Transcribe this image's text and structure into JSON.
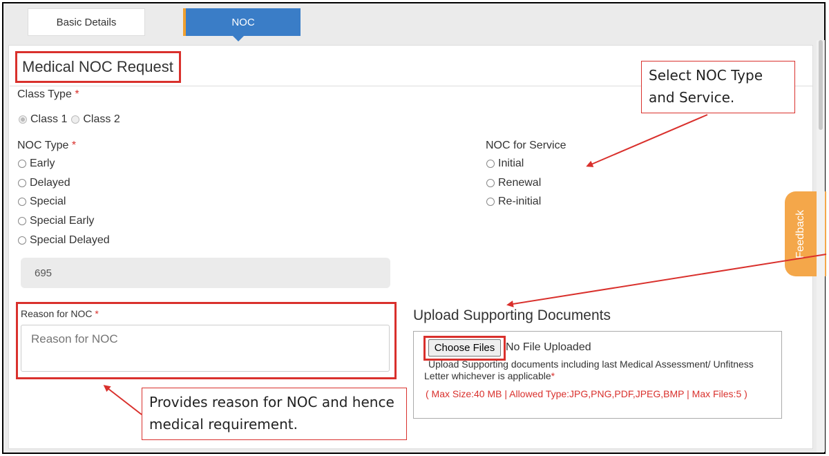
{
  "tabs": [
    {
      "label": "Basic Details"
    },
    {
      "label": "NOC"
    }
  ],
  "form": {
    "title": "Medical NOC Request",
    "class_type": {
      "label": "Class Type",
      "required_mark": "*",
      "options": [
        "Class 1",
        "Class 2"
      ],
      "selected": "Class 1"
    },
    "noc_type": {
      "label": "NOC Type",
      "required_mark": "*",
      "options": [
        "Early",
        "Delayed",
        "Special",
        "Special Early",
        "Special Delayed"
      ]
    },
    "noc_service": {
      "label": "NOC for Service",
      "options": [
        "Initial",
        "Renewal",
        "Re-initial"
      ]
    },
    "readonly_value": "695",
    "reason": {
      "label": "Reason for NOC",
      "required_mark": "*",
      "placeholder": "Reason for NOC"
    }
  },
  "upload": {
    "title": "Upload Supporting Documents",
    "button_label": "Choose Files",
    "status": "No File Uploaded",
    "help_text": "Upload Supporting documents including last Medical Assessment/ Unfitness Letter whichever is applicable",
    "required_mark": "*",
    "limits": "( Max Size:40 MB | Allowed Type:JPG,PNG,PDF,JPEG,BMP | Max Files:5 )"
  },
  "callouts": {
    "noc": "Select NOC Type and Service.",
    "reason": "Provides reason for NOC and hence medical requirement."
  },
  "feedback": {
    "label": "Feedback"
  },
  "colors": {
    "tab_active": "#3a7dc7",
    "tab_accent": "#f0a030",
    "annotation_red": "#d9302c",
    "feedback": "#f4a74a"
  }
}
